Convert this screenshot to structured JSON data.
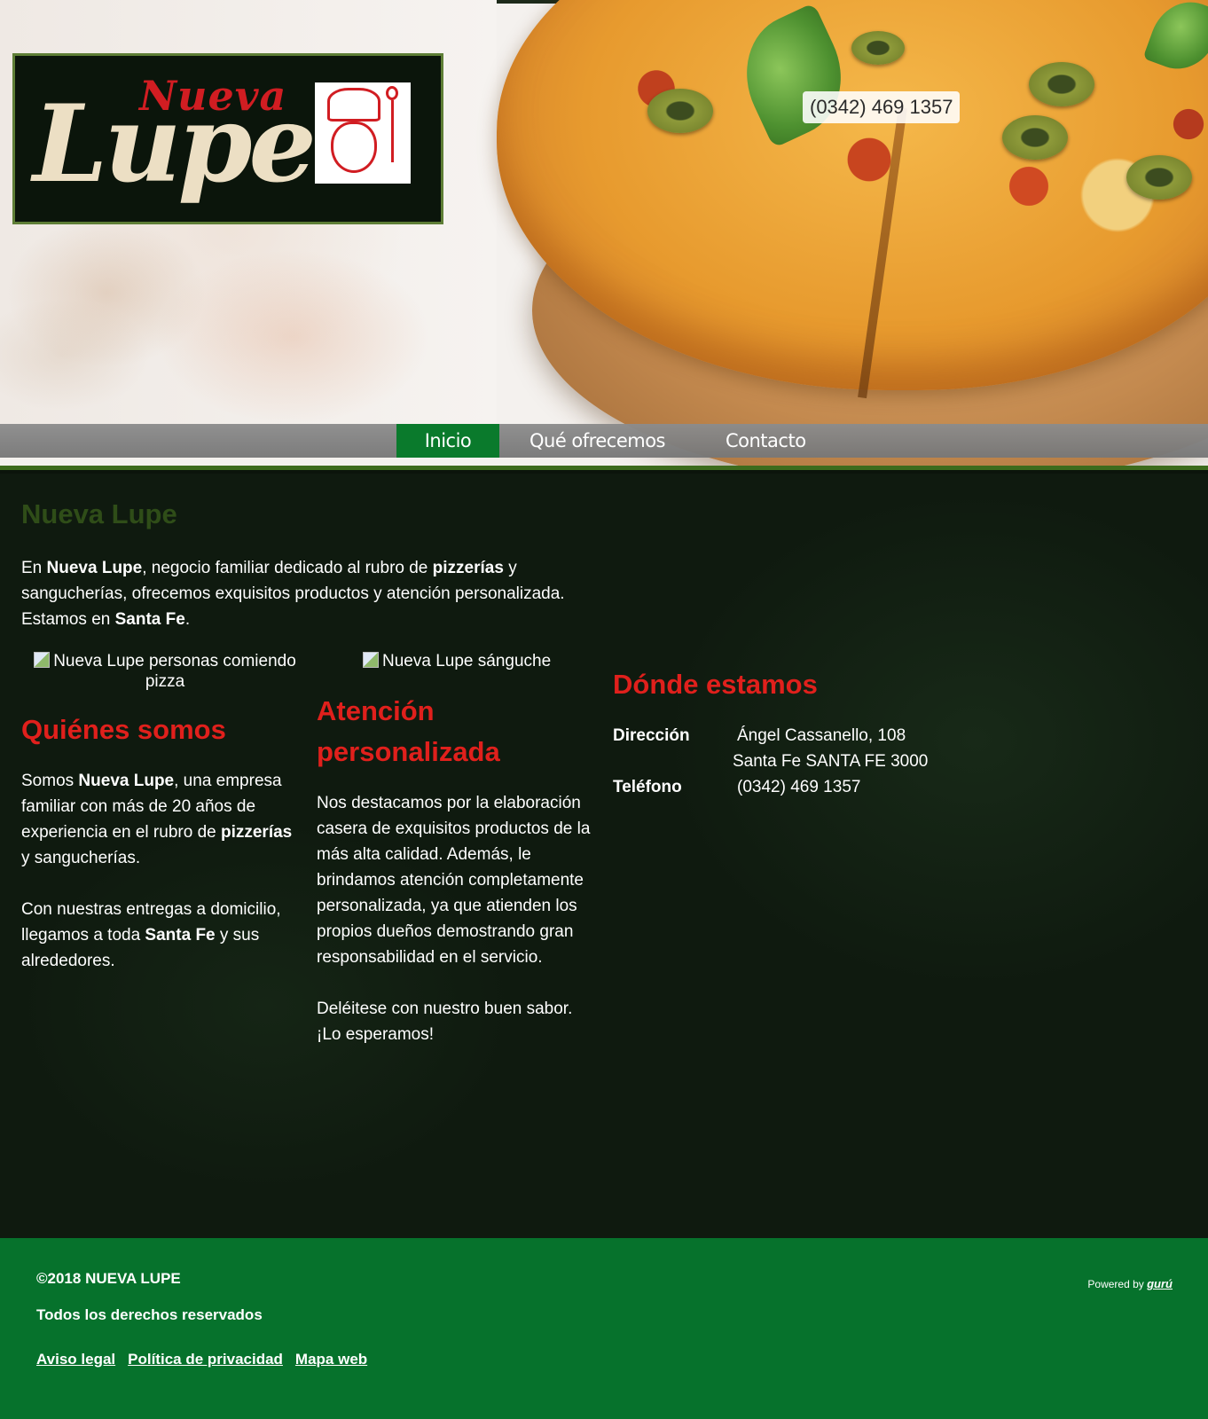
{
  "header": {
    "logo": {
      "word1": "Nueva",
      "word2": "Lupe"
    },
    "phone": "(0342) 469 1357"
  },
  "nav": {
    "items": [
      {
        "label": "Inicio",
        "active": true
      },
      {
        "label": "Qué ofrecemos",
        "active": false
      },
      {
        "label": "Contacto",
        "active": false
      }
    ]
  },
  "main": {
    "title": "Nueva Lupe",
    "intro": {
      "t1": "En ",
      "b1": "Nueva Lupe",
      "t2": ", negocio familiar dedicado al rubro de ",
      "b2": "pizzerías",
      "t3": " y sangucherías, ofrecemos exquisitos productos y atención personalizada. Estamos en ",
      "b3": "Santa Fe",
      "t4": "."
    },
    "col1": {
      "img_alt": "Nueva Lupe personas comiendo pizza",
      "title": "Quiénes somos",
      "p1": {
        "t1": "Somos ",
        "b1": "Nueva Lupe",
        "t2": ", una empresa familiar con más de 20 años de experiencia en el rubro de ",
        "b2": "pizzerías",
        "t3": " y sangucherías."
      },
      "p2": {
        "t1": "Con nuestras entregas a domicilio, llegamos a toda ",
        "b1": "Santa Fe",
        "t2": " y sus alrededores."
      }
    },
    "col2": {
      "img_alt": "Nueva Lupe sánguche",
      "title": "Atención personalizada",
      "p1": "Nos destacamos por la elaboración casera de exquisitos productos de la más alta calidad. Además, le brindamos atención completamente personalizada, ya que atienden los propios dueños demostrando gran responsabilidad en el servicio.",
      "p2": "Deléitese con nuestro buen sabor. ¡Lo esperamos!"
    },
    "col3": {
      "title": "Dónde estamos",
      "address_label": "Dirección",
      "address_line1": "Ángel Cassanello, 108",
      "address_line2": "Santa Fe  SANTA FE  3000",
      "phone_label": "Teléfono",
      "phone_value": "(0342) 469 1357"
    }
  },
  "footer": {
    "copyright": "©2018 NUEVA LUPE",
    "rights": "Todos los derechos reservados",
    "links": [
      "Aviso legal",
      "Política de privacidad",
      "Mapa web"
    ],
    "powered_prefix": "Powered by ",
    "powered_brand": "gurú"
  },
  "colors": {
    "accent_red": "#e0201c",
    "nav_active_green": "#0a7a2c",
    "footer_green": "#06722c",
    "main_bg": "#0f1a0f"
  }
}
